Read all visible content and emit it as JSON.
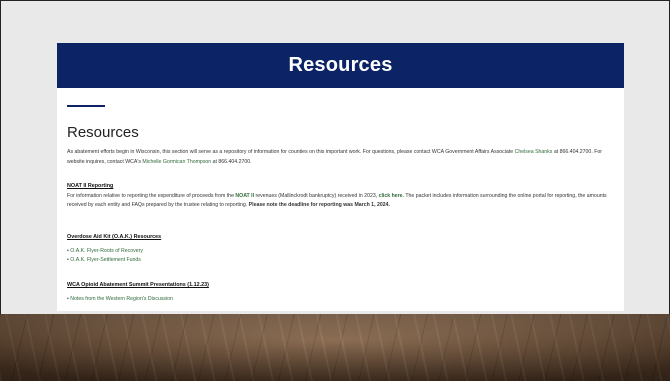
{
  "banner": {
    "title": "Resources"
  },
  "page": {
    "heading": "Resources",
    "intro": {
      "text1": "As abatement efforts begin in Wisconsin, this section will serve as a repository of information for counties on this important work. For questions, please contact WCA Government Affairs Associate ",
      "contact1": "Chelsea Shanks",
      "text2": " at 866.404.2700.  For website inquires, contact WCA's ",
      "contact2": "Michelle Gormican Thompson",
      "text3": " at 866.404.2700."
    }
  },
  "noat": {
    "title": "NOAT II Reporting",
    "text1": "For information relative to reporting the expenditure of proceeds from the ",
    "noat_link": "NOAT II",
    "text2": " revenues (Mallinckrodt bankruptcy) received in 2023, ",
    "click_here": "click here.",
    "text3": " The packet includes information surrounding the online portal for reporting, the amounts received by each entity and FAQs prepared by the trustee relating to reporting. ",
    "deadline": "Please note the deadline for reporting was March 1, 2024."
  },
  "oak": {
    "title": "Overdose Aid Kit (O.A.K.) Resources",
    "items": [
      "O.A.K. Flyer-Roots of Recovery",
      "O.A.K. Flyer-Settlement Funds"
    ]
  },
  "summit": {
    "title": "WCA Opioid Abatement Summit Presentations (1.12.23)",
    "items": [
      "Notes from the Western Region's Discussion"
    ]
  },
  "colors": {
    "banner": "#0c2466",
    "link": "#2f6a3a"
  }
}
